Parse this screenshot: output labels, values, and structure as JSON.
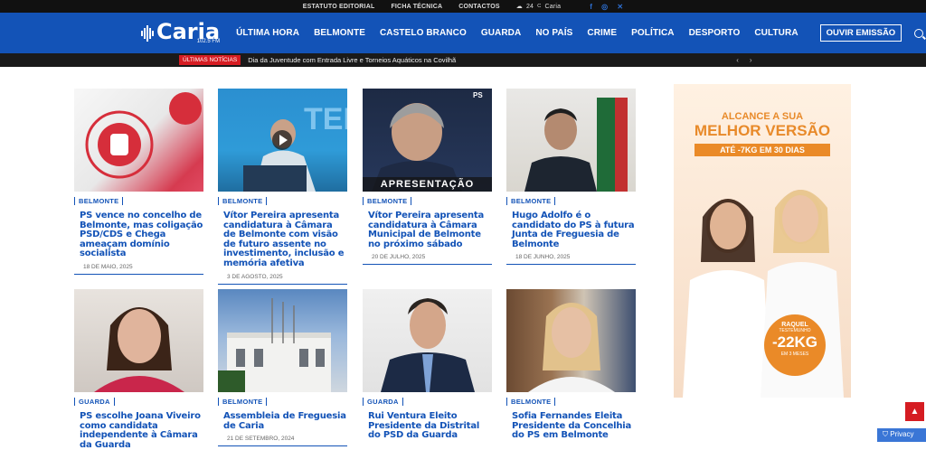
{
  "topbar": {
    "links": [
      "ESTATUTO EDITORIAL",
      "FICHA TÉCNICA",
      "CONTACTOS"
    ],
    "temp": "24",
    "unit": "C",
    "city": "Caria"
  },
  "logo": {
    "name": "Caria",
    "freq": "102.5 FM"
  },
  "nav": [
    "ÚLTIMA HORA",
    "BELMONTE",
    "CASTELO BRANCO",
    "GUARDA",
    "NO PAÍS",
    "CRIME",
    "POLÍTICA",
    "DESPORTO",
    "CULTURA"
  ],
  "listen": "OUVIR EMISSÃO",
  "ticker": {
    "label": "ÚLTIMAS NOTÍCIAS",
    "text": "Dia da Juventude com Entrada Livre e Torneios Aquáticos na Covilhã"
  },
  "cards": [
    {
      "cat": "BELMONTE",
      "title": "PS vence no concelho de Belmonte, mas coligação PSD/CDS e Chega ameaçam domínio socialista",
      "date": "18 DE MAIO, 2025"
    },
    {
      "cat": "BELMONTE",
      "title": "Vítor Pereira apresenta candidatura à Câmara de Belmonte com visão de futuro assente no investimento, inclusão e memória afetiva",
      "date": "3 DE AGOSTO, 2025"
    },
    {
      "cat": "BELMONTE",
      "title": "Vítor Pereira apresenta candidatura à Câmara Municipal de Belmonte no próximo sábado",
      "date": "20 DE JULHO, 2025",
      "overlay": "APRESENTAÇÃO"
    },
    {
      "cat": "BELMONTE",
      "title": "Hugo Adolfo é o candidato do PS à futura Junta de Freguesia de Belmonte",
      "date": "18 DE JUNHO, 2025"
    },
    {
      "cat": "GUARDA",
      "title": "PS escolhe Joana Viveiro como candidata independente à Câmara da Guarda",
      "date": ""
    },
    {
      "cat": "BELMONTE",
      "title": "Assembleia de Freguesia de Caria",
      "date": "21 DE SETEMBRO, 2024"
    },
    {
      "cat": "GUARDA",
      "title": "Rui Ventura Eleito Presidente da Distrital do PSD da Guarda",
      "date": ""
    },
    {
      "cat": "BELMONTE",
      "title": "Sofia Fernandes Eleita Presidente da Concelhia do PS em Belmonte",
      "date": ""
    }
  ],
  "ad": {
    "line1": "ALCANCE A SUA",
    "line2": "MELHOR VERSÃO",
    "line3": "ATÉ -7KG EM 30 DIAS",
    "name": "RAQUEL",
    "role": "TESTEMUNHO",
    "kg": "-22KG",
    "months": "EM 3 MESES"
  },
  "privacy": "Privacy",
  "colors": {
    "brand": "#1353b7",
    "accent": "#d51c22"
  }
}
